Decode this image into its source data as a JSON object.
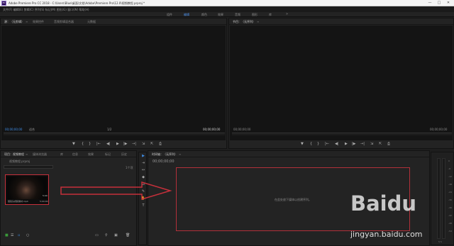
{
  "window": {
    "app_icon": "Pr",
    "title": "Adobe Premiere Pro CC 2018 - C:\\Users\\Blue\\桌面\\文档\\Adobe\\Premiere Pro\\12.0\\视频教程.prproj *",
    "minimize": "—",
    "maximize": "□",
    "close": "✕"
  },
  "menubar": {
    "text": "文件(F)  编辑(E)  剪辑(C)  序列(S)  标记(M)  图形(G)  窗口(W)  帮助(H)"
  },
  "workspaces": {
    "items": [
      "组件",
      "编辑",
      "颜色",
      "效果",
      "音频",
      "图形",
      "库"
    ],
    "active_index": 1,
    "more": "»"
  },
  "source_panel": {
    "tabs": [
      {
        "label": "源：（无剪辑）",
        "close": "≡"
      },
      {
        "label": "效果控件"
      },
      {
        "label": "音频剪辑混合器"
      },
      {
        "label": "元数据"
      }
    ],
    "timecode_left": "00;00;00;00",
    "fit": "适合",
    "page": "1/2",
    "timecode_right": "00;00;00;00",
    "controls": [
      "▼",
      "{",
      "}",
      "|←",
      "◀|",
      "▶",
      "|▶",
      "→|",
      "⇲",
      "⇱",
      "⎙"
    ]
  },
  "program_panel": {
    "tabs": [
      {
        "label": "节目：（无序列）",
        "close": "≡"
      }
    ],
    "timecode_left": "00;00;00;00",
    "timecode_right": "00;00;00;00",
    "controls": [
      "▼",
      "{",
      "}",
      "|←",
      "◀|",
      "▶",
      "|▶",
      "→|",
      "⇲",
      "⇱",
      "⎙"
    ]
  },
  "project_panel": {
    "tabs": [
      {
        "label": "项目：视频教程",
        "close": "≡"
      },
      {
        "label": "媒体浏览器"
      },
      {
        "label": "库"
      },
      {
        "label": "信息"
      },
      {
        "label": "效果"
      },
      {
        "label": "标记"
      },
      {
        "label": "历史"
      }
    ],
    "project_file": "视频教程.prproj",
    "item_count": "1个项",
    "clip": {
      "name": "慢镜头视频素材.mp4",
      "duration_badge": "5:00",
      "length": "5;00;00"
    },
    "bottom_controls": [
      "■",
      "☰",
      "▫",
      "○",
      "▭",
      "⚲",
      "▣",
      "🗑"
    ]
  },
  "timeline_panel": {
    "tabs": [
      {
        "label": "时间轴：（无序列）",
        "close": "≡"
      }
    ],
    "timecode": "00;00;00;00",
    "hint": "在此处放下媒体以创建序列。"
  },
  "tools": [
    "▶",
    "⇥",
    "↔",
    "◆",
    "⊿",
    "✎",
    "✋",
    "T"
  ],
  "meter": {
    "ticks": [
      "0",
      "-6",
      "-12",
      "-18",
      "-24",
      "-30",
      "-36",
      "-42",
      "-48",
      "-54"
    ],
    "footer": "S S"
  },
  "watermark": {
    "logo_text": "Baidu",
    "subtext": "jingyan.baidu.com"
  },
  "colors": {
    "accent_blue": "#3f8ee8",
    "highlight_red": "#c6303b",
    "panel_bg": "#232323",
    "screen_bg": "#141414"
  }
}
